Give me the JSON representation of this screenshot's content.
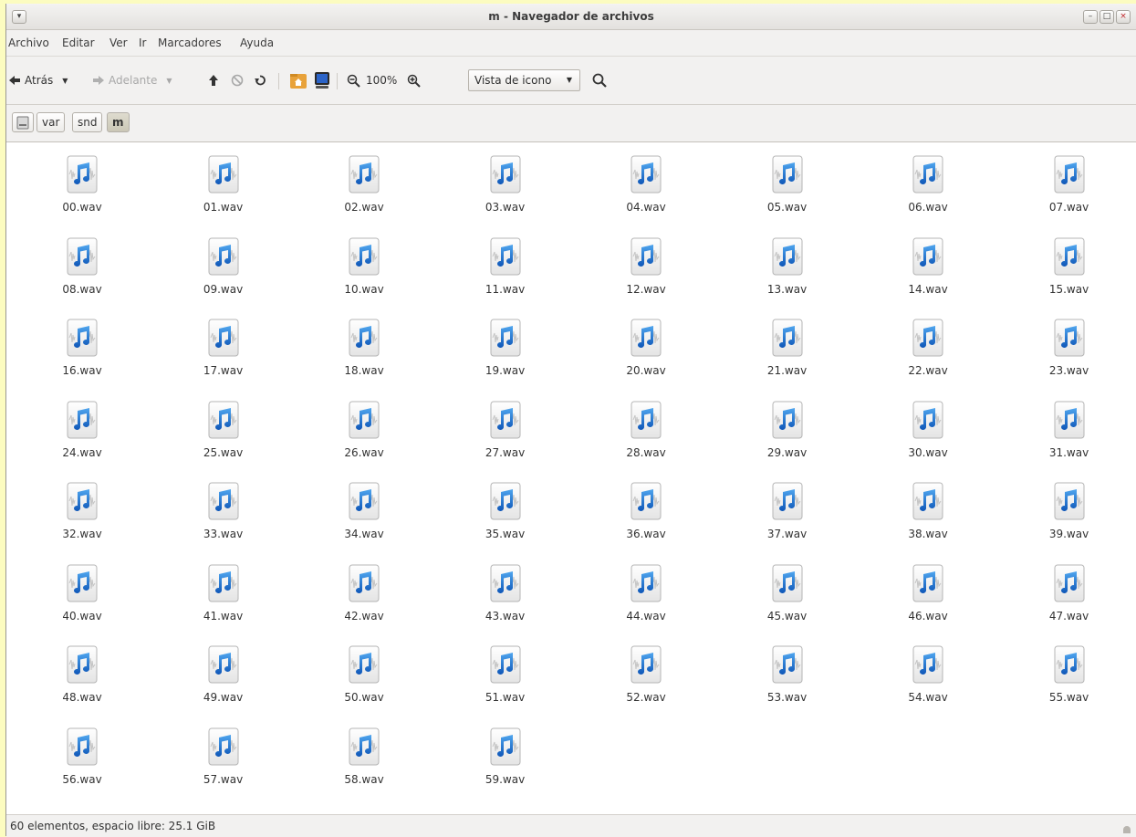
{
  "window": {
    "title": "m - Navegador de archivos",
    "buttons": [
      "–",
      "□",
      "×"
    ]
  },
  "menubar": [
    "Archivo",
    "Editar",
    "Ver",
    "Ir",
    "Marcadores",
    "Ayuda"
  ],
  "toolbar": {
    "back_label": "Atrás",
    "forward_label": "Adelante",
    "zoom_label": "100%",
    "view_mode": "Vista de icono"
  },
  "pathbar": [
    "var",
    "snd",
    "m"
  ],
  "files": [
    "00.wav",
    "01.wav",
    "02.wav",
    "03.wav",
    "04.wav",
    "05.wav",
    "06.wav",
    "07.wav",
    "08.wav",
    "09.wav",
    "10.wav",
    "11.wav",
    "12.wav",
    "13.wav",
    "14.wav",
    "15.wav",
    "16.wav",
    "17.wav",
    "18.wav",
    "19.wav",
    "20.wav",
    "21.wav",
    "22.wav",
    "23.wav",
    "24.wav",
    "25.wav",
    "26.wav",
    "27.wav",
    "28.wav",
    "29.wav",
    "30.wav",
    "31.wav",
    "32.wav",
    "33.wav",
    "34.wav",
    "35.wav",
    "36.wav",
    "37.wav",
    "38.wav",
    "39.wav",
    "40.wav",
    "41.wav",
    "42.wav",
    "43.wav",
    "44.wav",
    "45.wav",
    "46.wav",
    "47.wav",
    "48.wav",
    "49.wav",
    "50.wav",
    "51.wav",
    "52.wav",
    "53.wav",
    "54.wav",
    "55.wav",
    "56.wav",
    "57.wav",
    "58.wav",
    "59.wav"
  ],
  "file_icon": "audio-file-icon",
  "status": "60 elementos, espacio libre: 25.1 GiB",
  "colors": {
    "accent": "#1a6fc9",
    "window_bg": "#f2f1f0",
    "desktop_bg": "#fcfcc0"
  }
}
